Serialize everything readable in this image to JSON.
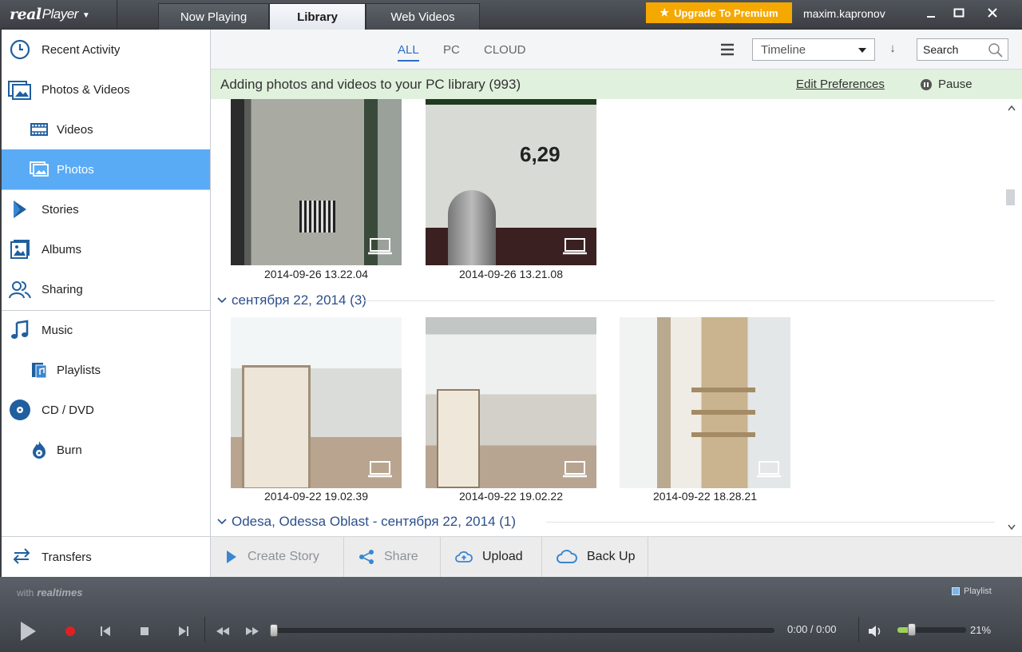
{
  "app": {
    "logo_real": "real",
    "logo_player": "Player",
    "username": "maxim.kapronov",
    "upgrade_label": "Upgrade To Premium",
    "accent_color": "#5aabf5",
    "upgrade_color": "#f5a800"
  },
  "tabs": [
    {
      "label": "Now Playing",
      "active": false
    },
    {
      "label": "Library",
      "active": true
    },
    {
      "label": "Web Videos",
      "active": false
    }
  ],
  "sidebar": {
    "items": [
      {
        "label": "Recent Activity",
        "icon": "clock-icon"
      },
      {
        "label": "Photos & Videos",
        "icon": "photos-videos-icon"
      },
      {
        "label": "Videos",
        "icon": "film-icon"
      },
      {
        "label": "Photos",
        "icon": "photo-icon",
        "selected": true
      },
      {
        "label": "Stories",
        "icon": "stories-icon"
      },
      {
        "label": "Albums",
        "icon": "album-icon"
      },
      {
        "label": "Sharing",
        "icon": "people-icon"
      },
      {
        "label": "Music",
        "icon": "music-note-icon"
      },
      {
        "label": "Playlists",
        "icon": "playlist-icon"
      },
      {
        "label": "CD / DVD",
        "icon": "disc-icon"
      },
      {
        "label": "Burn",
        "icon": "burn-icon"
      }
    ],
    "transfers_label": "Transfers"
  },
  "toolbar": {
    "filters": [
      "ALL",
      "PC",
      "CLOUD"
    ],
    "active_filter": "ALL",
    "sort_value": "Timeline",
    "search_value": "Search"
  },
  "banner": {
    "message": "Adding photos and videos to your PC library (993)",
    "edit_prefs_label": "Edit Preferences",
    "pause_label": "Pause"
  },
  "content": {
    "photos_top": [
      {
        "caption": "2014-09-26 13.22.04"
      },
      {
        "caption": "2014-09-26 13.21.08"
      }
    ],
    "group1": {
      "title": "сентября 22, 2014 (3)"
    },
    "photos_group1": [
      {
        "caption": "2014-09-22 19.02.39"
      },
      {
        "caption": "2014-09-22 19.02.22"
      },
      {
        "caption": "2014-09-22 18.28.21"
      }
    ],
    "group2": {
      "title": "Odesa, Odessa Oblast - сентября 22, 2014 (1)"
    }
  },
  "actions": {
    "create_story": "Create Story",
    "share": "Share",
    "upload": "Upload",
    "back_up": "Back Up"
  },
  "player": {
    "with_label": "with",
    "realtimes_label": "realtimes",
    "playlist_label": "Playlist",
    "time": "0:00 / 0:00",
    "volume_fraction": 0.21,
    "volume_label": "21%",
    "seek_fraction": 0
  }
}
